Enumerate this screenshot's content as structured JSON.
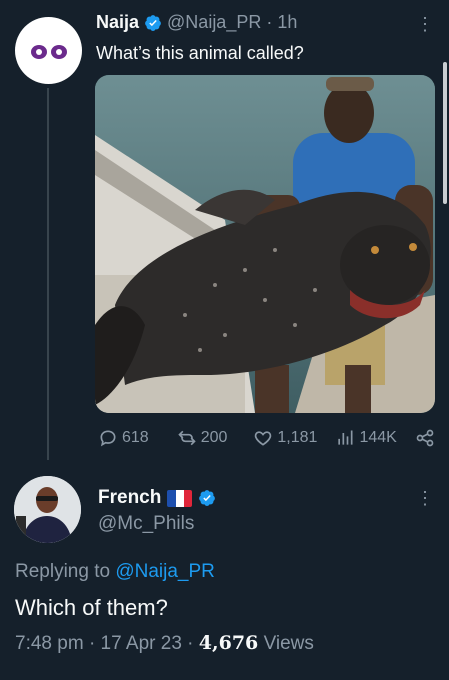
{
  "original_tweet": {
    "author_name": "Naija",
    "handle": "@Naija_PR",
    "separator": "·",
    "time": "1h",
    "text": "What’s this animal called?",
    "stats": {
      "replies": "618",
      "retweets": "200",
      "likes": "1,181",
      "views": "144K"
    }
  },
  "reply_tweet": {
    "author_name": "French",
    "handle": "@Mc_Phils",
    "replying_label": "Replying to ",
    "replying_handle": "@Naija_PR",
    "text": "Which of them?",
    "time": "7:48 pm",
    "date": "17 Apr 23",
    "views_count": "4,676",
    "views_label": "Views",
    "sep": "·"
  },
  "colors": {
    "background": "#15202b",
    "accent": "#1d9bf0",
    "muted": "#8b98a5"
  }
}
